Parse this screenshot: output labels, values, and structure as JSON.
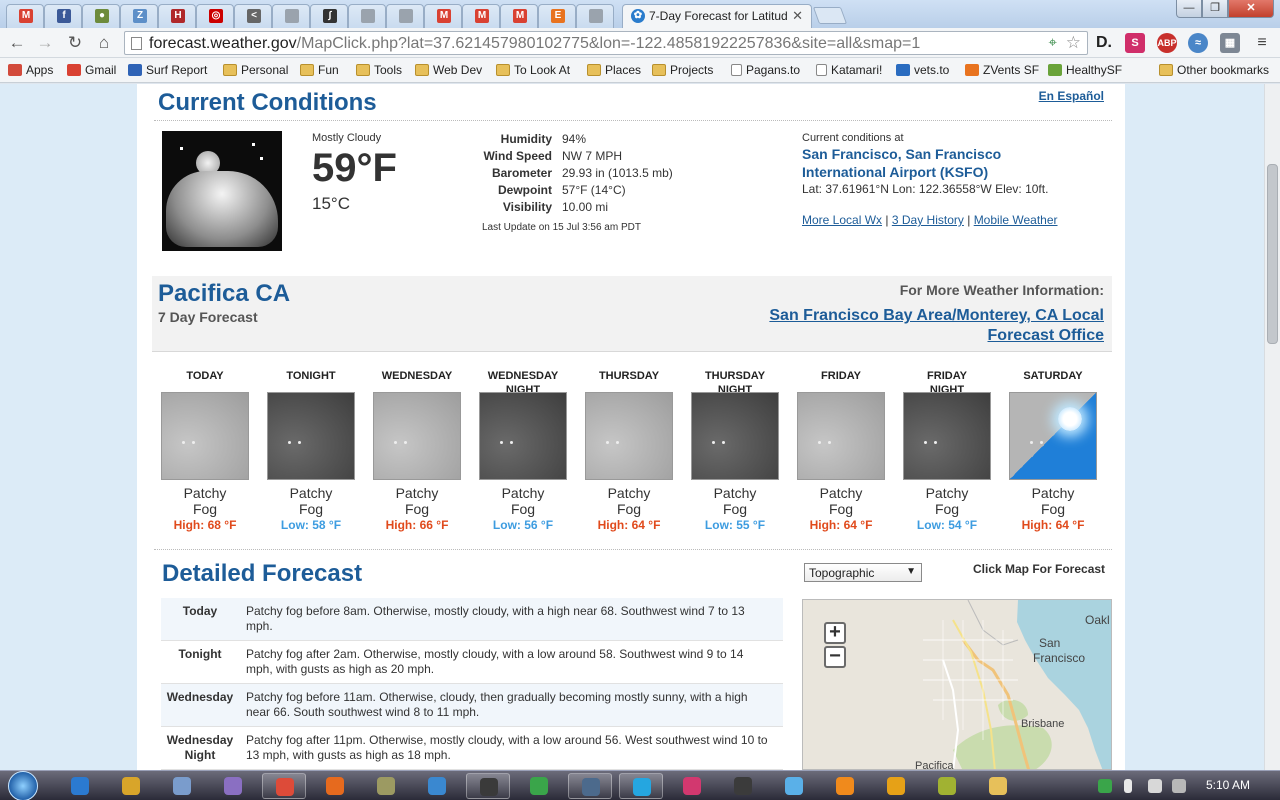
{
  "browser": {
    "active_tab_title": "7-Day Forecast for Latitud",
    "url_host": "forecast.weather.gov",
    "url_path": "/MapClick.php?lat=37.621457980102775&lon=-122.48581922257836&site=all&smap=1",
    "tabs": [
      {
        "icon": "gmail-icon",
        "color": "#d94132",
        "glyph": "M"
      },
      {
        "icon": "facebook-icon",
        "color": "#3b5998",
        "glyph": "f"
      },
      {
        "icon": "feed-icon",
        "color": "#6d8b3c",
        "glyph": "●"
      },
      {
        "icon": "zen-icon",
        "color": "#5d8fc8",
        "glyph": "Z"
      },
      {
        "icon": "hbr-icon",
        "color": "#b0282a",
        "glyph": "H"
      },
      {
        "icon": "target-icon",
        "color": "#cc0000",
        "glyph": "◎"
      },
      {
        "icon": "arrow-icon",
        "color": "#666666",
        "glyph": "<"
      },
      {
        "icon": "page-icon",
        "color": "#9aa3ad",
        "glyph": ""
      },
      {
        "icon": "chart-icon",
        "color": "#333333",
        "glyph": "∫"
      },
      {
        "icon": "page-icon",
        "color": "#9aa3ad",
        "glyph": ""
      },
      {
        "icon": "page-icon",
        "color": "#9aa3ad",
        "glyph": ""
      },
      {
        "icon": "gmail-icon",
        "color": "#d94132",
        "glyph": "M"
      },
      {
        "icon": "gmail-icon",
        "color": "#d94132",
        "glyph": "M"
      },
      {
        "icon": "gmail-icon",
        "color": "#d94132",
        "glyph": "M"
      },
      {
        "icon": "etsy-icon",
        "color": "#e8731f",
        "glyph": "E"
      },
      {
        "icon": "page-icon",
        "color": "#9aa3ad",
        "glyph": ""
      }
    ]
  },
  "bookmarks": [
    {
      "label": "Apps",
      "icon": "apps-icon"
    },
    {
      "label": "Gmail",
      "icon": "gmail-icon"
    },
    {
      "label": "Surf Report",
      "icon": "surf-icon"
    },
    {
      "label": "Personal",
      "icon": "folder-icon"
    },
    {
      "label": "Fun",
      "icon": "folder-icon"
    },
    {
      "label": "Tools",
      "icon": "folder-icon"
    },
    {
      "label": "Web Dev",
      "icon": "folder-icon"
    },
    {
      "label": "To Look At",
      "icon": "folder-icon"
    },
    {
      "label": "Places",
      "icon": "folder-icon"
    },
    {
      "label": "Projects",
      "icon": "folder-icon"
    },
    {
      "label": "Pagans.to",
      "icon": "page-icon"
    },
    {
      "label": "Katamari!",
      "icon": "page-icon"
    },
    {
      "label": "vets.to",
      "icon": "vets-icon"
    },
    {
      "label": "ZVents SF",
      "icon": "zvents-icon"
    },
    {
      "label": "HealthySF",
      "icon": "healthy-icon"
    },
    {
      "label": "Other bookmarks",
      "icon": "folder-icon"
    }
  ],
  "current": {
    "title": "Current Conditions",
    "espanol": "En Español",
    "summary": "Mostly Cloudy",
    "temp_f": "59°F",
    "temp_c": "15°C",
    "details": [
      {
        "k": "Humidity",
        "v": "94%"
      },
      {
        "k": "Wind Speed",
        "v": "NW 7 MPH"
      },
      {
        "k": "Barometer",
        "v": "29.93 in (1013.5 mb)"
      },
      {
        "k": "Dewpoint",
        "v": "57°F (14°C)"
      },
      {
        "k": "Visibility",
        "v": "10.00 mi"
      }
    ],
    "last_update": "Last Update on 15 Jul 3:56 am PDT",
    "station_label": "Current conditions at",
    "station": "San Francisco, San Francisco International Airport (KSFO)",
    "latlon": "Lat: 37.61961°N Lon: 122.36558°W Elev: 10ft.",
    "links": [
      "More Local Wx",
      "3 Day History",
      "Mobile Weather"
    ],
    "separator": "|"
  },
  "location": {
    "name": "Pacifica CA",
    "subtitle": "7 Day Forecast",
    "more_label": "For More Weather Information:",
    "more_link_1": "San Francisco Bay Area/Monterey, CA Local",
    "more_link_2": "Forecast Office"
  },
  "periods": [
    {
      "name1": "TODAY",
      "name2": "",
      "kind": "day",
      "short1": "Patchy",
      "short2": "Fog",
      "temp": "High: 68 °F",
      "hl": "hi"
    },
    {
      "name1": "TONIGHT",
      "name2": "",
      "kind": "night",
      "short1": "Patchy",
      "short2": "Fog",
      "temp": "Low: 58 °F",
      "hl": "lo"
    },
    {
      "name1": "WEDNESDAY",
      "name2": "",
      "kind": "day",
      "short1": "Patchy",
      "short2": "Fog",
      "temp": "High: 66 °F",
      "hl": "hi"
    },
    {
      "name1": "WEDNESDAY",
      "name2": "NIGHT",
      "kind": "night",
      "short1": "Patchy",
      "short2": "Fog",
      "temp": "Low: 56 °F",
      "hl": "lo"
    },
    {
      "name1": "THURSDAY",
      "name2": "",
      "kind": "day",
      "short1": "Patchy",
      "short2": "Fog",
      "temp": "High: 64 °F",
      "hl": "hi"
    },
    {
      "name1": "THURSDAY",
      "name2": "NIGHT",
      "kind": "night",
      "short1": "Patchy",
      "short2": "Fog",
      "temp": "Low: 55 °F",
      "hl": "lo"
    },
    {
      "name1": "FRIDAY",
      "name2": "",
      "kind": "day",
      "short1": "Patchy",
      "short2": "Fog",
      "temp": "High: 64 °F",
      "hl": "hi"
    },
    {
      "name1": "FRIDAY",
      "name2": "NIGHT",
      "kind": "night",
      "short1": "Patchy",
      "short2": "Fog",
      "temp": "Low: 54 °F",
      "hl": "lo"
    },
    {
      "name1": "SATURDAY",
      "name2": "",
      "kind": "sun",
      "short1": "Patchy",
      "short2": "Fog",
      "temp": "High: 64 °F",
      "hl": "hi"
    }
  ],
  "detailed": {
    "title": "Detailed Forecast",
    "rows": [
      {
        "label": "Today",
        "text": "Patchy fog before 8am. Otherwise, mostly cloudy, with a high near 68. Southwest wind 7 to 13 mph."
      },
      {
        "label": "Tonight",
        "text": "Patchy fog after 2am. Otherwise, mostly cloudy, with a low around 58. Southwest wind 9 to 14 mph, with gusts as high as 20 mph."
      },
      {
        "label": "Wednesday",
        "text": "Patchy fog before 11am. Otherwise, cloudy, then gradually becoming mostly sunny, with a high near 66. South southwest wind 8 to 11 mph."
      },
      {
        "label": "Wednesday Night",
        "text": "Patchy fog after 11pm. Otherwise, mostly cloudy, with a low around 56. West southwest wind 10 to 13 mph, with gusts as high as 18 mph."
      }
    ]
  },
  "map": {
    "select_value": "Topographic",
    "hint": "Click Map For Forecast",
    "zoom_in": "+",
    "zoom_out": "−",
    "labels": {
      "oakland": "Oakl",
      "san": "San",
      "francisco": "Francisco",
      "brisbane": "Brisbane",
      "pacifica": "Pacifica"
    }
  },
  "taskbar": {
    "clock": "5:10 AM",
    "items": [
      {
        "icon": "ie-icon",
        "color": "#2b7ad0",
        "open": false
      },
      {
        "icon": "winamp-icon",
        "color": "#d8a52a",
        "open": false
      },
      {
        "icon": "explorer-icon",
        "color": "#7a9ccc",
        "open": false
      },
      {
        "icon": "pidgin-icon",
        "color": "#8a6fc2",
        "open": false
      },
      {
        "icon": "chrome-icon",
        "color": "#dd4b39",
        "open": true
      },
      {
        "icon": "firefox-icon",
        "color": "#e66a1e",
        "open": false
      },
      {
        "icon": "tool-icon",
        "color": "#9c9a62",
        "open": false
      },
      {
        "icon": "skype-icon",
        "color": "#3a88d0",
        "open": false
      },
      {
        "icon": "notepad-icon",
        "color": "#3a3a3a",
        "open": true
      },
      {
        "icon": "green-icon",
        "color": "#3aa54a",
        "open": false
      },
      {
        "icon": "terminal-icon",
        "color": "#4c6a8c",
        "open": true
      },
      {
        "icon": "photoshop-icon",
        "color": "#25a6e0",
        "open": true
      },
      {
        "icon": "indesign-icon",
        "color": "#d2386f",
        "open": false
      },
      {
        "icon": "app-icon",
        "color": "#3b3b3b",
        "open": false
      },
      {
        "icon": "itunes-icon",
        "color": "#5ab0e8",
        "open": false
      },
      {
        "icon": "vlc-icon",
        "color": "#f08a1c",
        "open": false
      },
      {
        "icon": "plex-icon",
        "color": "#e6a117",
        "open": false
      },
      {
        "icon": "bug-icon",
        "color": "#a1b232",
        "open": false
      },
      {
        "icon": "folder-icon",
        "color": "#e7c05a",
        "open": false
      }
    ]
  }
}
